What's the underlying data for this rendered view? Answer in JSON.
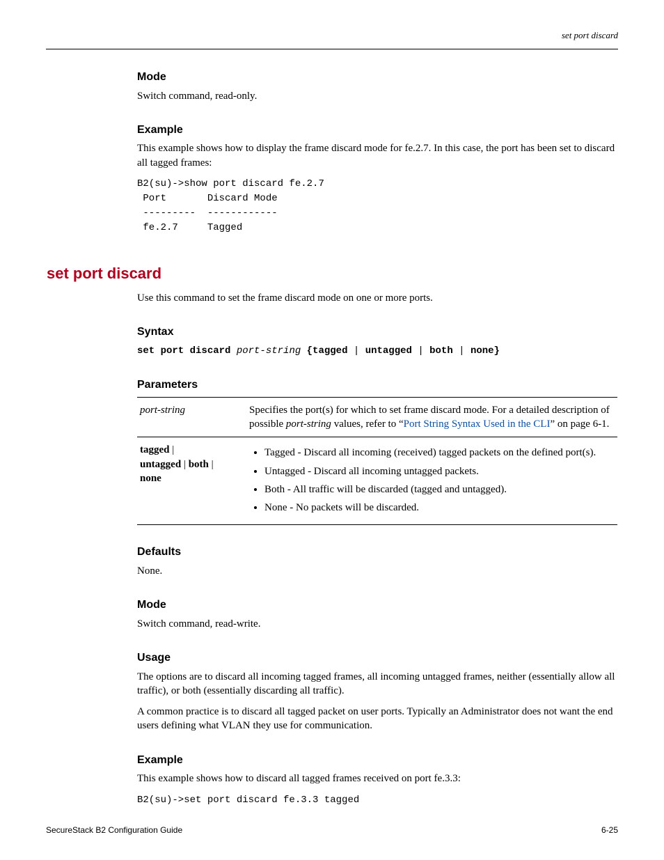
{
  "header": {
    "right": "set port discard"
  },
  "sec_mode": {
    "heading": "Mode",
    "body": "Switch command, read-only."
  },
  "sec_example1": {
    "heading": "Example",
    "body": "This example shows how to display the frame discard mode for fe.2.7. In this case, the port has been set to discard all tagged frames:",
    "code_line1": "B2(su)->show port discard fe.2.7",
    "code_line2": " Port       Discard Mode",
    "code_line3": " ---------  ------------",
    "code_line4": " fe.2.7     Tagged"
  },
  "cmd": {
    "title": "set port discard",
    "desc": "Use this command to set the frame discard mode on one or more ports."
  },
  "sec_syntax": {
    "heading": "Syntax",
    "kw1": "set port discard",
    "arg1": "port-string",
    "kw2_part1": "{tagged",
    "kw2_part2": "untagged",
    "kw2_part3": "both",
    "kw2_part4": "none}"
  },
  "sec_params": {
    "heading": "Parameters",
    "row1": {
      "arg": "port-string",
      "desc_pre": "Specifies the port(s) for which to set frame discard mode. For a detailed description of possible ",
      "desc_arg": "port-string",
      "desc_mid": " values, refer to “",
      "link": "Port String Syntax Used in the CLI",
      "desc_post": "” on page 6-1."
    },
    "row2": {
      "arg_l1a": "tagged",
      "arg_l1b": " | ",
      "arg_l2a": "untagged",
      "arg_l2b": " | ",
      "arg_l2c": "both",
      "arg_l2d": " | ",
      "arg_l3": "none",
      "b1": "Tagged - Discard all incoming (received) tagged packets on the defined port(s).",
      "b2": "Untagged - Discard all incoming untagged packets.",
      "b3": "Both - All traffic will be discarded (tagged and untagged).",
      "b4": "None - No packets will be discarded."
    }
  },
  "sec_defaults": {
    "heading": "Defaults",
    "body": "None."
  },
  "sec_mode2": {
    "heading": "Mode",
    "body": "Switch command, read-write."
  },
  "sec_usage": {
    "heading": "Usage",
    "p1": "The options are to discard all incoming tagged frames, all incoming untagged frames, neither (essentially allow all traffic), or both (essentially discarding all traffic).",
    "p2": "A common practice is to discard all tagged packet on user ports. Typically an Administrator does not want the end users defining what VLAN they use for communication."
  },
  "sec_example2": {
    "heading": "Example",
    "body_pre": "This example shows how to discard all tagged frames received on port ",
    "body_port": "fe",
    "body_post": ".3.3:",
    "code": "B2(su)->set port discard fe.3.3 tagged"
  },
  "footer": {
    "left": "SecureStack B2 Configuration Guide",
    "right": "6-25"
  }
}
